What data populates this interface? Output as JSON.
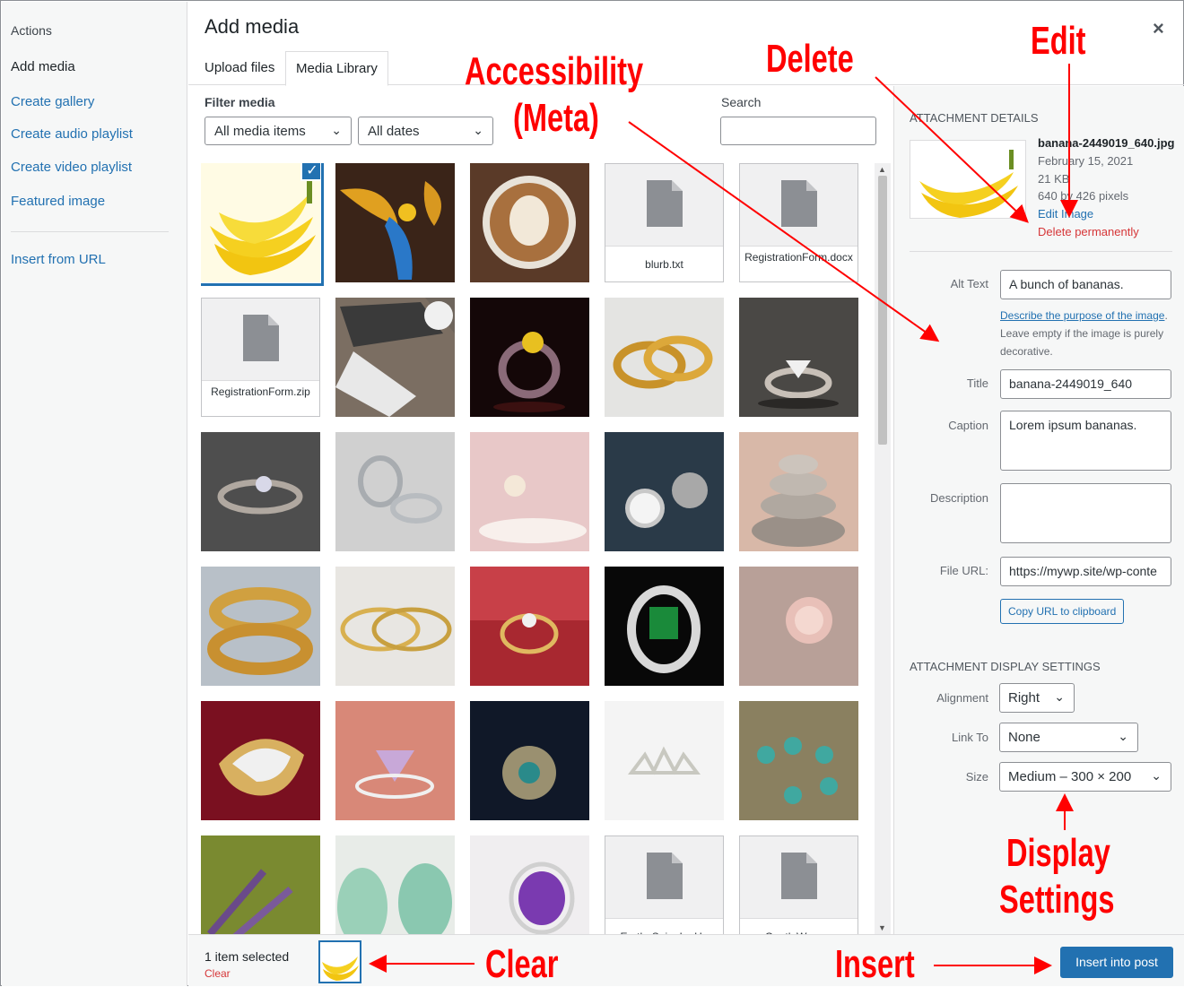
{
  "sidebar": {
    "heading": "Actions",
    "items": [
      "Add media",
      "Create gallery",
      "Create audio playlist",
      "Create video playlist",
      "Featured image",
      "Insert from URL"
    ]
  },
  "modal": {
    "title": "Add media",
    "close": "×"
  },
  "tabs": [
    "Upload files",
    "Media Library"
  ],
  "filter": {
    "label": "Filter media",
    "type_value": "All media items",
    "date_value": "All dates",
    "search_label": "Search",
    "search_value": ""
  },
  "grid": {
    "checkmark": "✓",
    "files": {
      "blurb": "blurb.txt",
      "regdocx": "RegistrationForm.docx",
      "regzip": "RegistrationForm.zip",
      "earth": "Earth_Spin_In_Ha",
      "gentle": "GentleWaves-"
    }
  },
  "details": {
    "title": "Attachment Details",
    "filename": "banana-2449019_640.jpg",
    "date": "February 15, 2021",
    "size": "21 KB",
    "dimensions": "640 by 426 pixels",
    "edit_link": "Edit Image",
    "delete_link": "Delete permanently",
    "alt_label": "Alt Text",
    "alt_value": "A bunch of bananas.",
    "help_link": "Describe the purpose of the image",
    "help_text": ". Leave empty if the image is purely decorative.",
    "title_label": "Title",
    "title_value": "banana-2449019_640",
    "caption_label": "Caption",
    "caption_value": "Lorem ipsum bananas.",
    "description_label": "Description",
    "description_value": "",
    "url_label": "File URL:",
    "url_value": "https://mywp.site/wp-conte",
    "copy_button": "Copy URL to clipboard"
  },
  "display": {
    "title": "Attachment Display Settings",
    "alignment_label": "Alignment",
    "alignment_value": "Right",
    "link_label": "Link To",
    "link_value": "None",
    "size_label": "Size",
    "size_value": "Medium – 300 × 200"
  },
  "toolbar": {
    "selected": "1 item selected",
    "clear": "Clear",
    "insert_button": "Insert into post"
  },
  "annotations": {
    "accessibility_1": "Accessibility",
    "accessibility_2": "(Meta)",
    "delete": "Delete",
    "edit": "Edit",
    "display_1": "Display",
    "display_2": "Settings",
    "clear": "Clear",
    "insert": "Insert"
  },
  "colors": {
    "accent": "#2271b1",
    "danger": "#d63638",
    "annotation": "#ff0000"
  }
}
